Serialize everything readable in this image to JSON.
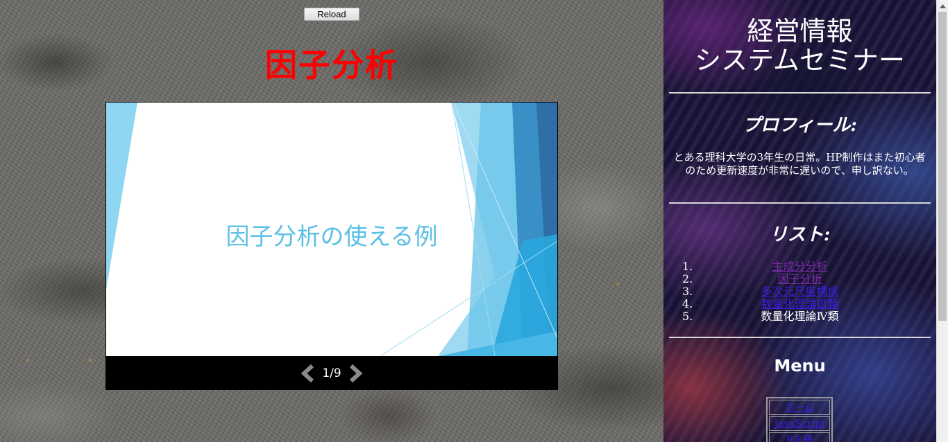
{
  "toolbar": {
    "reload_label": "Reload"
  },
  "page": {
    "title": "因子分析"
  },
  "slideshow": {
    "slide_text": "因子分析の使える例",
    "counter": "1/9",
    "current": 1,
    "total": 9
  },
  "sidebar": {
    "site_title_line1": "経営情報",
    "site_title_line2": "システムセミナー",
    "profile_heading": "プロフィール:",
    "profile_text": "とある理科大学の3年生の日常。HP制作はまた初心者のため更新速度が非常に遅いので、申し訳ない。",
    "list_heading": "リスト:",
    "list_items": [
      {
        "num": "1.",
        "label": "主成分分析"
      },
      {
        "num": "2.",
        "label": "因子分析"
      },
      {
        "num": "3.",
        "label": "多次元尺度構成"
      },
      {
        "num": "4.",
        "label": "数量化理論Ⅲ類"
      },
      {
        "num": "5.",
        "label": "数量化理論Ⅳ類"
      }
    ],
    "menu_heading": "Menu",
    "menu_items": [
      "ホーム",
      "JavaScript",
      "R言語"
    ]
  },
  "colors": {
    "page_title": "#ff0000",
    "slide_text": "#5bc0e5",
    "link": "#3a1fe0",
    "visited_link": "#7b2aa8"
  }
}
